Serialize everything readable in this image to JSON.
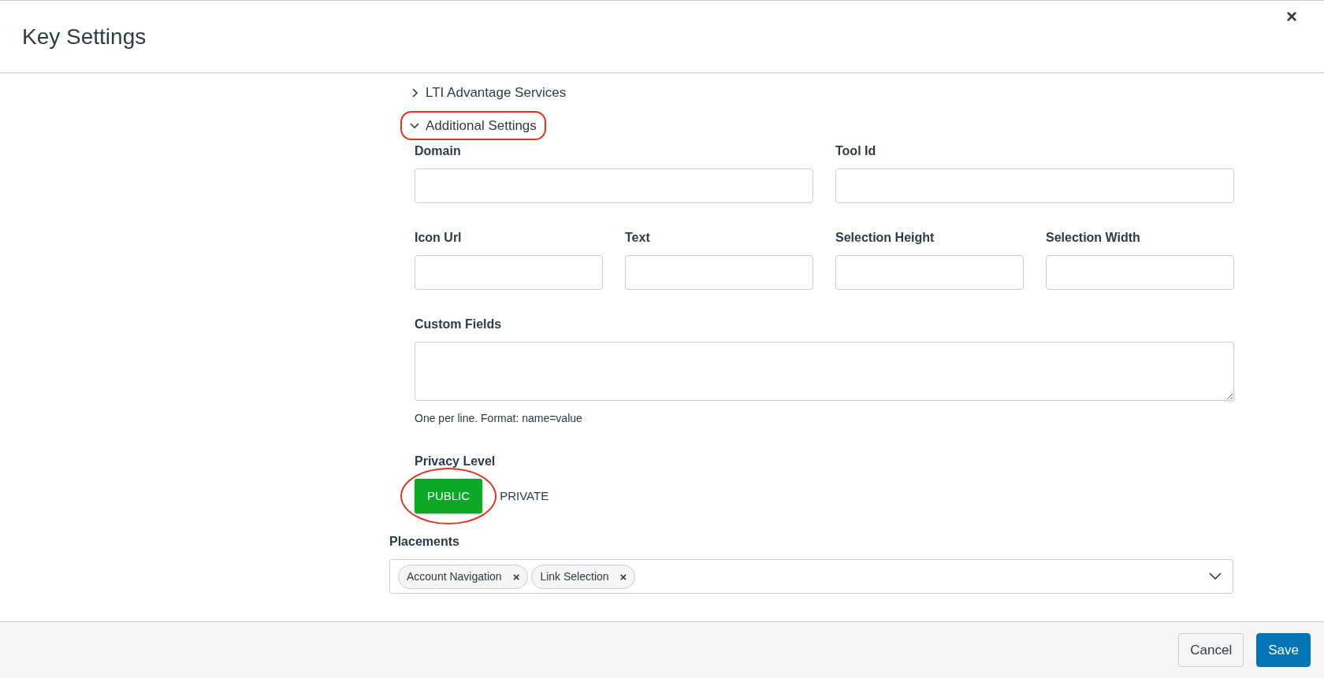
{
  "window": {
    "title": "Key Settings",
    "close": "×"
  },
  "sections": [
    {
      "label": "LTI Advantage Services",
      "expanded": false,
      "highlighted": false
    },
    {
      "label": "Additional Settings",
      "expanded": true,
      "highlighted": true
    }
  ],
  "fields": {
    "domain": {
      "label": "Domain"
    },
    "tool_id": {
      "label": "Tool Id"
    },
    "icon_url": {
      "label": "Icon Url"
    },
    "text": {
      "label": "Text"
    },
    "selection_height": {
      "label": "Selection Height"
    },
    "selection_width": {
      "label": "Selection Width"
    }
  },
  "custom_fields": {
    "label": "Custom Fields",
    "help": "One per line. Format: name=value"
  },
  "privacy_level": {
    "label": "Privacy Level",
    "highlighted": true,
    "options": [
      {
        "label": "PUBLIC",
        "selected": true
      },
      {
        "label": "PRIVATE",
        "selected": false
      }
    ]
  },
  "placements": {
    "label": "Placements",
    "tags": [
      {
        "label": "Account Navigation",
        "remove": "×"
      },
      {
        "label": "Link Selection",
        "remove": "×"
      }
    ]
  },
  "buttons": [
    {
      "label": "Cancel",
      "kind": "secondary"
    },
    {
      "label": "Save",
      "kind": "primary"
    }
  ]
}
